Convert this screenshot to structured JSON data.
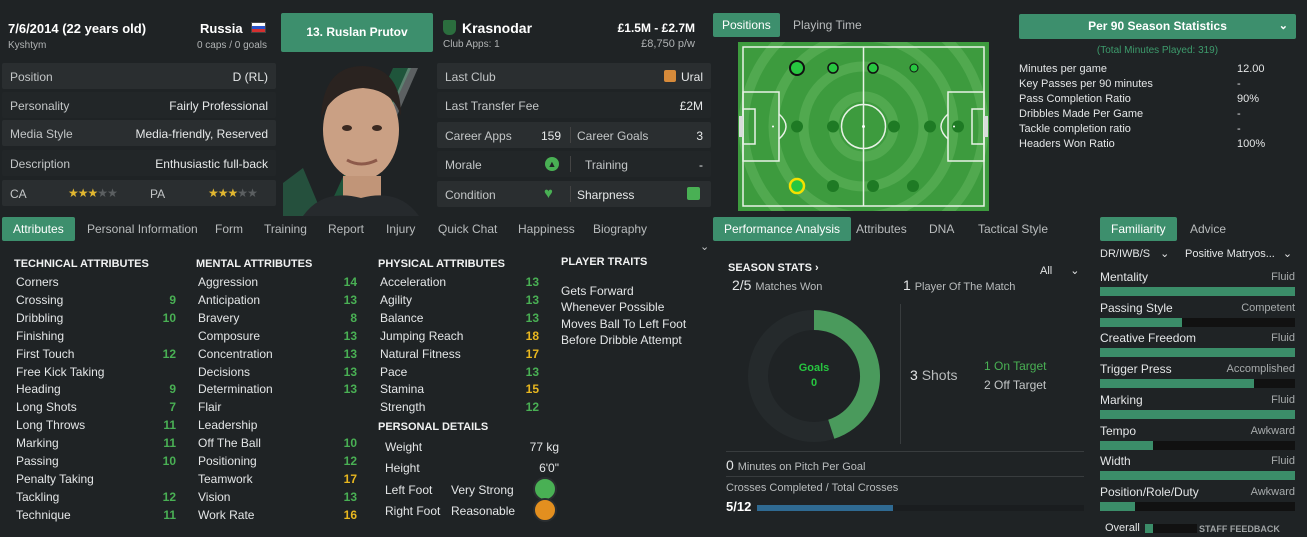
{
  "header": {
    "dob": "7/6/2014 (22 years old)",
    "birthplace": "Kyshtym",
    "nation": "Russia",
    "caps": "0 caps / 0 goals",
    "player_button": "13. Ruslan Prutov",
    "club": "Krasnodar",
    "club_apps": "Club Apps: 1",
    "value": "£1.5M - £2.7M",
    "wage": "£8,750 p/w"
  },
  "info_left": [
    {
      "label": "Position",
      "value": "D (RL)"
    },
    {
      "label": "Personality",
      "value": "Fairly Professional"
    },
    {
      "label": "Media Style",
      "value": "Media-friendly, Reserved"
    },
    {
      "label": "Description",
      "value": "Enthusiastic full-back"
    }
  ],
  "ratings": {
    "ca_label": "CA",
    "pa_label": "PA",
    "ca_stars": 2.5,
    "pa_stars": 2.5
  },
  "info_right": {
    "last_club_label": "Last Club",
    "last_club": "Ural",
    "fee_label": "Last Transfer Fee",
    "fee": "£2M",
    "career_apps_label": "Career Apps",
    "career_apps": "159",
    "career_goals_label": "Career Goals",
    "career_goals": "3",
    "morale_label": "Morale",
    "training_label": "Training",
    "training": "-",
    "condition_label": "Condition",
    "sharpness_label": "Sharpness"
  },
  "pitch_tabs": [
    "Positions",
    "Playing Time"
  ],
  "stats_panel": {
    "dropdown": "Per 90 Season Statistics",
    "minutes_note": "(Total Minutes Played: 319)",
    "rows": [
      {
        "label": "Minutes per game",
        "value": "12.00"
      },
      {
        "label": "Key Passes per 90 minutes",
        "value": "-"
      },
      {
        "label": "Pass Completion Ratio",
        "value": "90%"
      },
      {
        "label": "Dribbles Made Per Game",
        "value": "-"
      },
      {
        "label": "Tackle completion ratio",
        "value": "-"
      },
      {
        "label": "Headers Won Ratio",
        "value": "100%"
      }
    ]
  },
  "tabs_left": [
    "Attributes",
    "Personal Information",
    "Form",
    "Training",
    "Report",
    "Injury",
    "Quick Chat",
    "Happiness",
    "Biography"
  ],
  "tabs_mid": [
    "Performance Analysis",
    "Attributes",
    "DNA",
    "Tactical Style"
  ],
  "tabs_right": [
    "Familiarity",
    "Advice"
  ],
  "technical": {
    "title": "TECHNICAL ATTRIBUTES",
    "items": [
      {
        "n": "Corners",
        "v": ""
      },
      {
        "n": "Crossing",
        "v": "9"
      },
      {
        "n": "Dribbling",
        "v": "10"
      },
      {
        "n": "Finishing",
        "v": ""
      },
      {
        "n": "First Touch",
        "v": "12"
      },
      {
        "n": "Free Kick Taking",
        "v": ""
      },
      {
        "n": "Heading",
        "v": "9"
      },
      {
        "n": "Long Shots",
        "v": "7"
      },
      {
        "n": "Long Throws",
        "v": "11"
      },
      {
        "n": "Marking",
        "v": "11"
      },
      {
        "n": "Passing",
        "v": "10"
      },
      {
        "n": "Penalty Taking",
        "v": ""
      },
      {
        "n": "Tackling",
        "v": "12"
      },
      {
        "n": "Technique",
        "v": "11"
      }
    ]
  },
  "mental": {
    "title": "MENTAL ATTRIBUTES",
    "items": [
      {
        "n": "Aggression",
        "v": "14"
      },
      {
        "n": "Anticipation",
        "v": "13"
      },
      {
        "n": "Bravery",
        "v": "8"
      },
      {
        "n": "Composure",
        "v": "13"
      },
      {
        "n": "Concentration",
        "v": "13"
      },
      {
        "n": "Decisions",
        "v": "13"
      },
      {
        "n": "Determination",
        "v": "13"
      },
      {
        "n": "Flair",
        "v": ""
      },
      {
        "n": "Leadership",
        "v": ""
      },
      {
        "n": "Off The Ball",
        "v": "10"
      },
      {
        "n": "Positioning",
        "v": "12"
      },
      {
        "n": "Teamwork",
        "v": "17"
      },
      {
        "n": "Vision",
        "v": "13"
      },
      {
        "n": "Work Rate",
        "v": "16"
      }
    ]
  },
  "physical": {
    "title": "PHYSICAL ATTRIBUTES",
    "items": [
      {
        "n": "Acceleration",
        "v": "13"
      },
      {
        "n": "Agility",
        "v": "13"
      },
      {
        "n": "Balance",
        "v": "13"
      },
      {
        "n": "Jumping Reach",
        "v": "18"
      },
      {
        "n": "Natural Fitness",
        "v": "17"
      },
      {
        "n": "Pace",
        "v": "13"
      },
      {
        "n": "Stamina",
        "v": "15"
      },
      {
        "n": "Strength",
        "v": "12"
      }
    ]
  },
  "personal": {
    "title": "PERSONAL DETAILS",
    "weight_label": "Weight",
    "weight": "77 kg",
    "height_label": "Height",
    "height": "6'0\"",
    "left_foot_label": "Left Foot",
    "left_foot": "Very Strong",
    "right_foot_label": "Right Foot",
    "right_foot": "Reasonable"
  },
  "traits": {
    "title": "PLAYER TRAITS",
    "items": [
      "Gets Forward Whenever Possible",
      "Moves Ball To Left Foot Before Dribble Attempt"
    ]
  },
  "season": {
    "title": "SEASON STATS",
    "filter": "All",
    "matches_won_val": "2/5",
    "matches_won": "Matches Won",
    "potm_val": "1",
    "potm": "Player Of The Match",
    "donut_label": "Goals",
    "donut_value": "0",
    "shots_val": "3",
    "shots": "Shots",
    "on_target": "1 On Target",
    "off_target": "2 Off Target",
    "minutes_val": "0",
    "minutes": "Minutes on Pitch Per Goal",
    "crosses_label": "Crosses Completed / Total Crosses",
    "crosses": "5/12",
    "crosses_fraction": 0.4167
  },
  "familiarity": {
    "role": "DR/IWB/S",
    "instruction": "Positive Matryos...",
    "items": [
      {
        "n": "Mentality",
        "r": "Fluid",
        "f": 1.0
      },
      {
        "n": "Passing Style",
        "r": "Competent",
        "f": 0.42
      },
      {
        "n": "Creative Freedom",
        "r": "Fluid",
        "f": 1.0
      },
      {
        "n": "Trigger Press",
        "r": "Accomplished",
        "f": 0.79
      },
      {
        "n": "Marking",
        "r": "Fluid",
        "f": 1.0
      },
      {
        "n": "Tempo",
        "r": "Awkward",
        "f": 0.27
      },
      {
        "n": "Width",
        "r": "Fluid",
        "f": 1.0
      },
      {
        "n": "Position/Role/Duty",
        "r": "Awkward",
        "f": 0.18
      }
    ],
    "overall": "Overall",
    "feedback": "STAFF FEEDBACK"
  },
  "colors": {
    "accent": "#3d8f6d",
    "good": "#49b054",
    "warn": "#e8b71f"
  }
}
